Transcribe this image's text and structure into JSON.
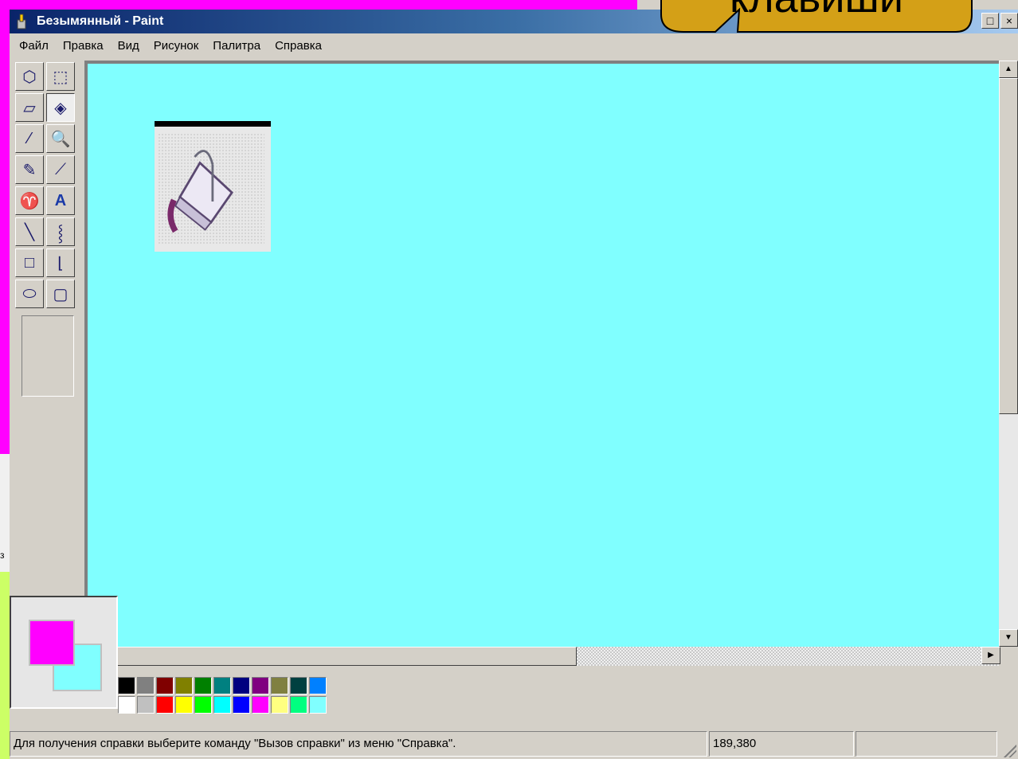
{
  "window": {
    "title": "Безымянный - Paint",
    "controls": [
      "□",
      "×"
    ]
  },
  "menu": [
    "Файл",
    "Правка",
    "Вид",
    "Рисунок",
    "Палитра",
    "Справка"
  ],
  "tools": [
    {
      "name": "free-select-icon",
      "glyph": "⬡"
    },
    {
      "name": "rect-select-icon",
      "glyph": "⬚"
    },
    {
      "name": "eraser-icon",
      "glyph": "▱"
    },
    {
      "name": "fill-bucket-icon",
      "glyph": "◈",
      "active": true
    },
    {
      "name": "color-picker-icon",
      "glyph": "⁄"
    },
    {
      "name": "magnifier-icon",
      "glyph": "🔍"
    },
    {
      "name": "pencil-icon",
      "glyph": "✎"
    },
    {
      "name": "brush-icon",
      "glyph": "⟋"
    },
    {
      "name": "airbrush-icon",
      "glyph": "♈"
    },
    {
      "name": "text-icon",
      "glyph": "A"
    },
    {
      "name": "line-icon",
      "glyph": "╲"
    },
    {
      "name": "curve-icon",
      "glyph": "⸾"
    },
    {
      "name": "rectangle-icon",
      "glyph": "□"
    },
    {
      "name": "polygon-icon",
      "glyph": "⌊"
    },
    {
      "name": "ellipse-icon",
      "glyph": "⬭"
    },
    {
      "name": "rounded-rect-icon",
      "glyph": "▢"
    }
  ],
  "colors": {
    "foreground": "#ff00ff",
    "background": "#80ffff",
    "canvas": "#80ffff"
  },
  "palette": [
    "#000000",
    "#808080",
    "#800000",
    "#808000",
    "#008000",
    "#008080",
    "#000080",
    "#800080",
    "#808040",
    "#004040",
    "#0080ff",
    "#ffffff",
    "#c0c0c0",
    "#ff0000",
    "#ffff00",
    "#00ff00",
    "#00ffff",
    "#0000ff",
    "#ff00ff",
    "#ffff80",
    "#00ff80",
    "#80ffff"
  ],
  "status": {
    "help_text": "Для получения справки выберите команду \"Вызов справки\" из меню \"Справка\".",
    "coordinates": "189,380",
    "size": ""
  },
  "callout": {
    "text": "клавиши"
  },
  "sliver_text": "з"
}
